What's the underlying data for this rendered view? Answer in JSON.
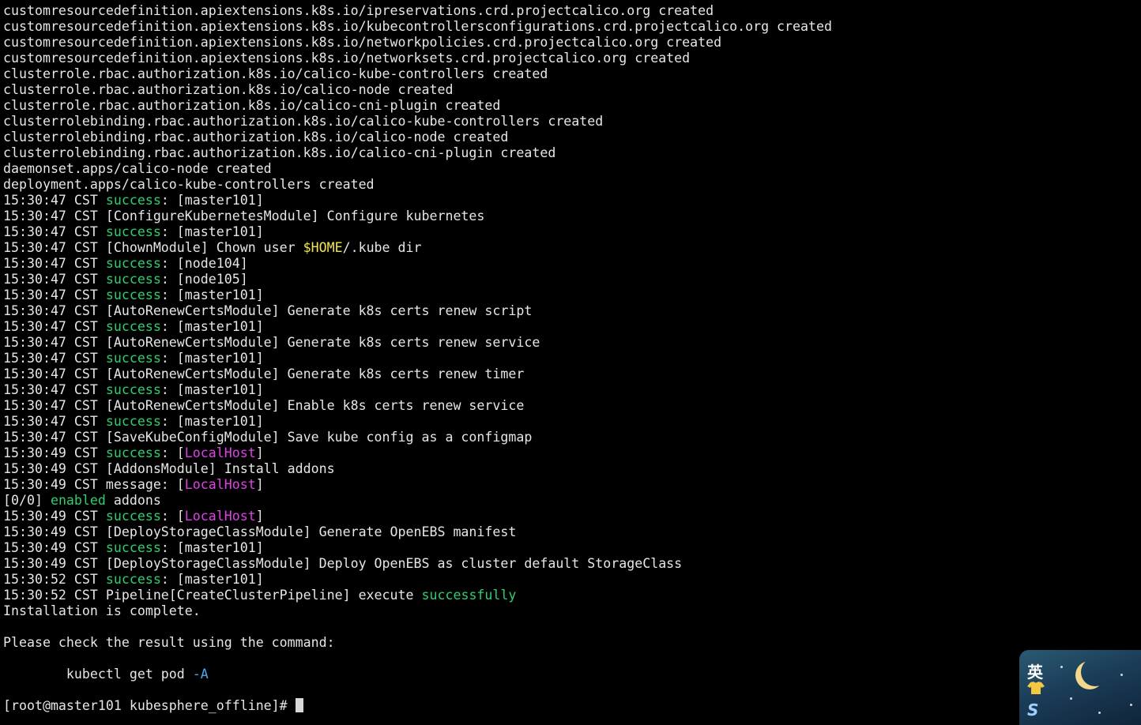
{
  "colors": {
    "default": "#e6e6e6",
    "green": "#2ed06e",
    "magenta": "#e040e8",
    "yellow": "#f2e74a",
    "blue": "#4aa8f0",
    "background": "#000000"
  },
  "terminal": {
    "lines": [
      [
        {
          "t": "customresourcedefinition.apiextensions.k8s.io/ipreservations.crd.projectcalico.org created"
        }
      ],
      [
        {
          "t": "customresourcedefinition.apiextensions.k8s.io/kubecontrollersconfigurations.crd.projectcalico.org created"
        }
      ],
      [
        {
          "t": "customresourcedefinition.apiextensions.k8s.io/networkpolicies.crd.projectcalico.org created"
        }
      ],
      [
        {
          "t": "customresourcedefinition.apiextensions.k8s.io/networksets.crd.projectcalico.org created"
        }
      ],
      [
        {
          "t": "clusterrole.rbac.authorization.k8s.io/calico-kube-controllers created"
        }
      ],
      [
        {
          "t": "clusterrole.rbac.authorization.k8s.io/calico-node created"
        }
      ],
      [
        {
          "t": "clusterrole.rbac.authorization.k8s.io/calico-cni-plugin created"
        }
      ],
      [
        {
          "t": "clusterrolebinding.rbac.authorization.k8s.io/calico-kube-controllers created"
        }
      ],
      [
        {
          "t": "clusterrolebinding.rbac.authorization.k8s.io/calico-node created"
        }
      ],
      [
        {
          "t": "clusterrolebinding.rbac.authorization.k8s.io/calico-cni-plugin created"
        }
      ],
      [
        {
          "t": "daemonset.apps/calico-node created"
        }
      ],
      [
        {
          "t": "deployment.apps/calico-kube-controllers created"
        }
      ],
      [
        {
          "t": "15:30:47 CST "
        },
        {
          "t": "success",
          "c": "green"
        },
        {
          "t": ": [master101]"
        }
      ],
      [
        {
          "t": "15:30:47 CST [ConfigureKubernetesModule] Configure kubernetes"
        }
      ],
      [
        {
          "t": "15:30:47 CST "
        },
        {
          "t": "success",
          "c": "green"
        },
        {
          "t": ": [master101]"
        }
      ],
      [
        {
          "t": "15:30:47 CST [ChownModule] Chown user "
        },
        {
          "t": "$HOME",
          "c": "yellow"
        },
        {
          "t": "/.kube dir"
        }
      ],
      [
        {
          "t": "15:30:47 CST "
        },
        {
          "t": "success",
          "c": "green"
        },
        {
          "t": ": [node104]"
        }
      ],
      [
        {
          "t": "15:30:47 CST "
        },
        {
          "t": "success",
          "c": "green"
        },
        {
          "t": ": [node105]"
        }
      ],
      [
        {
          "t": "15:30:47 CST "
        },
        {
          "t": "success",
          "c": "green"
        },
        {
          "t": ": [master101]"
        }
      ],
      [
        {
          "t": "15:30:47 CST [AutoRenewCertsModule] Generate k8s certs renew script"
        }
      ],
      [
        {
          "t": "15:30:47 CST "
        },
        {
          "t": "success",
          "c": "green"
        },
        {
          "t": ": [master101]"
        }
      ],
      [
        {
          "t": "15:30:47 CST [AutoRenewCertsModule] Generate k8s certs renew service"
        }
      ],
      [
        {
          "t": "15:30:47 CST "
        },
        {
          "t": "success",
          "c": "green"
        },
        {
          "t": ": [master101]"
        }
      ],
      [
        {
          "t": "15:30:47 CST [AutoRenewCertsModule] Generate k8s certs renew timer"
        }
      ],
      [
        {
          "t": "15:30:47 CST "
        },
        {
          "t": "success",
          "c": "green"
        },
        {
          "t": ": [master101]"
        }
      ],
      [
        {
          "t": "15:30:47 CST [AutoRenewCertsModule] Enable k8s certs renew service"
        }
      ],
      [
        {
          "t": "15:30:47 CST "
        },
        {
          "t": "success",
          "c": "green"
        },
        {
          "t": ": [master101]"
        }
      ],
      [
        {
          "t": "15:30:47 CST [SaveKubeConfigModule] Save kube config as a configmap"
        }
      ],
      [
        {
          "t": "15:30:49 CST "
        },
        {
          "t": "success",
          "c": "green"
        },
        {
          "t": ": ["
        },
        {
          "t": "LocalHost",
          "c": "magenta"
        },
        {
          "t": "]"
        }
      ],
      [
        {
          "t": "15:30:49 CST [AddonsModule] Install addons"
        }
      ],
      [
        {
          "t": "15:30:49 CST message: ["
        },
        {
          "t": "LocalHost",
          "c": "magenta"
        },
        {
          "t": "]"
        }
      ],
      [
        {
          "t": "[0/0] "
        },
        {
          "t": "enabled",
          "c": "green"
        },
        {
          "t": " addons"
        }
      ],
      [
        {
          "t": "15:30:49 CST "
        },
        {
          "t": "success",
          "c": "green"
        },
        {
          "t": ": ["
        },
        {
          "t": "LocalHost",
          "c": "magenta"
        },
        {
          "t": "]"
        }
      ],
      [
        {
          "t": "15:30:49 CST [DeployStorageClassModule] Generate OpenEBS manifest"
        }
      ],
      [
        {
          "t": "15:30:49 CST "
        },
        {
          "t": "success",
          "c": "green"
        },
        {
          "t": ": [master101]"
        }
      ],
      [
        {
          "t": "15:30:49 CST [DeployStorageClassModule] Deploy OpenEBS as cluster default StorageClass"
        }
      ],
      [
        {
          "t": "15:30:52 CST "
        },
        {
          "t": "success",
          "c": "green"
        },
        {
          "t": ": [master101]"
        }
      ],
      [
        {
          "t": "15:30:52 CST Pipeline[CreateClusterPipeline] execute "
        },
        {
          "t": "successfully",
          "c": "green"
        }
      ],
      [
        {
          "t": "Installation is complete."
        }
      ],
      [],
      [
        {
          "t": "Please check the result using the command:"
        }
      ],
      [],
      [
        {
          "t": "        kubectl get pod "
        },
        {
          "t": "-A",
          "c": "blue"
        }
      ],
      []
    ],
    "prompt": "[root@master101 kubesphere_offline]# "
  },
  "ime": {
    "mode_glyph": "英",
    "icon_names": [
      "skin-shirt-icon",
      "sogou-logo-icon",
      "crescent-moon-icon"
    ]
  }
}
